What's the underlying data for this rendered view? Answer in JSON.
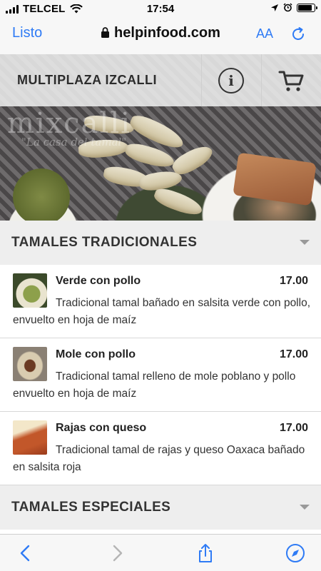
{
  "status_bar": {
    "carrier": "TELCEL",
    "time": "17:54",
    "battery_level": 0.85
  },
  "browser": {
    "done_label": "Listo",
    "url": "helpinfood.com",
    "text_size_label": "AA"
  },
  "header": {
    "store_name": "MULTIPLAZA IZCALLI"
  },
  "hero": {
    "watermark_text": "mixcalli",
    "watermark_subtext": "\"La casa del tamal\""
  },
  "sections": [
    {
      "title": "TAMALES TRADICIONALES",
      "items": [
        {
          "name": "Verde con pollo",
          "price": "17.00",
          "description": "Tradicional tamal bañado en salsita verde con pollo, envuelto en hoja de maíz"
        },
        {
          "name": "Mole con pollo",
          "price": "17.00",
          "description": "Tradicional tamal relleno de mole poblano y pollo envuelto en hoja de maíz"
        },
        {
          "name": "Rajas con queso",
          "price": "17.00",
          "description": "Tradicional tamal de rajas y queso Oaxaca bañado en salsita roja"
        }
      ]
    },
    {
      "title": "TAMALES ESPECIALES",
      "items": []
    }
  ],
  "colors": {
    "ios_blue": "#2f7bf5",
    "section_bg": "#eeeeee",
    "text_dark": "#222222"
  }
}
